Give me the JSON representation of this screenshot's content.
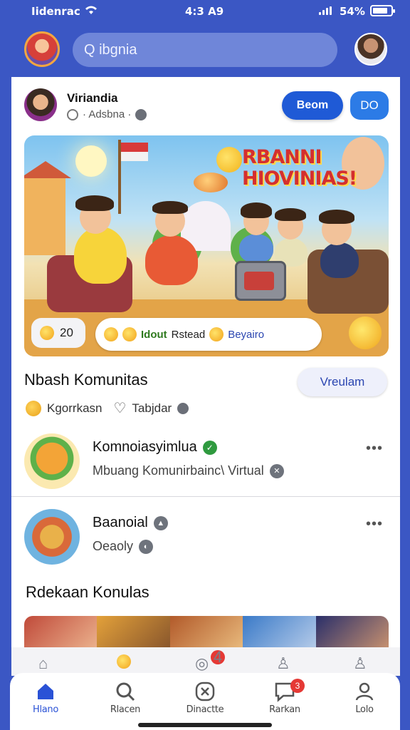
{
  "status_bar": {
    "carrier": "Iidenrac",
    "time": "4:3 A9",
    "battery_percent": "54%"
  },
  "top_bar": {
    "search_placeholder": "Q ibgnia"
  },
  "post": {
    "author": "Viriandia",
    "meta": "· Adsbna ·",
    "primary_button": "Beom",
    "secondary_button": "DO",
    "banner_title": "RBANNI HIOVINIAS!",
    "likes_count": "20",
    "reaction_text_1": "Idout",
    "reaction_text_2": "Rstead",
    "reaction_text_3": "Beyairo"
  },
  "section": {
    "title": "Nbash Komunitas",
    "button": "Vreulam",
    "meta_1": "Kgorrkasn",
    "meta_2": "Tabjdar"
  },
  "communities": [
    {
      "title": "Komnoiasyimlua",
      "subtitle": "Mbuang Komunirbainc\\ Virtual"
    },
    {
      "title": "Baanoial",
      "subtitle": "Oeaoly"
    }
  ],
  "section2": {
    "title": "Rdekaan Konulas"
  },
  "bottom_nav": {
    "items": [
      {
        "label": "Hlano",
        "icon": "home-icon"
      },
      {
        "label": "Rlacen",
        "icon": "search-icon"
      },
      {
        "label": "Dinactte",
        "icon": "close-circle-icon"
      },
      {
        "label": "Rarkan",
        "icon": "chat-icon",
        "badge": "3"
      },
      {
        "label": "Lolo",
        "icon": "user-icon"
      }
    ],
    "ghost_badge": "4"
  },
  "colors": {
    "brand": "#3b57c4",
    "primary_button": "#1f5ad6",
    "nav_active": "#2a52d6",
    "badge": "#e53935"
  }
}
